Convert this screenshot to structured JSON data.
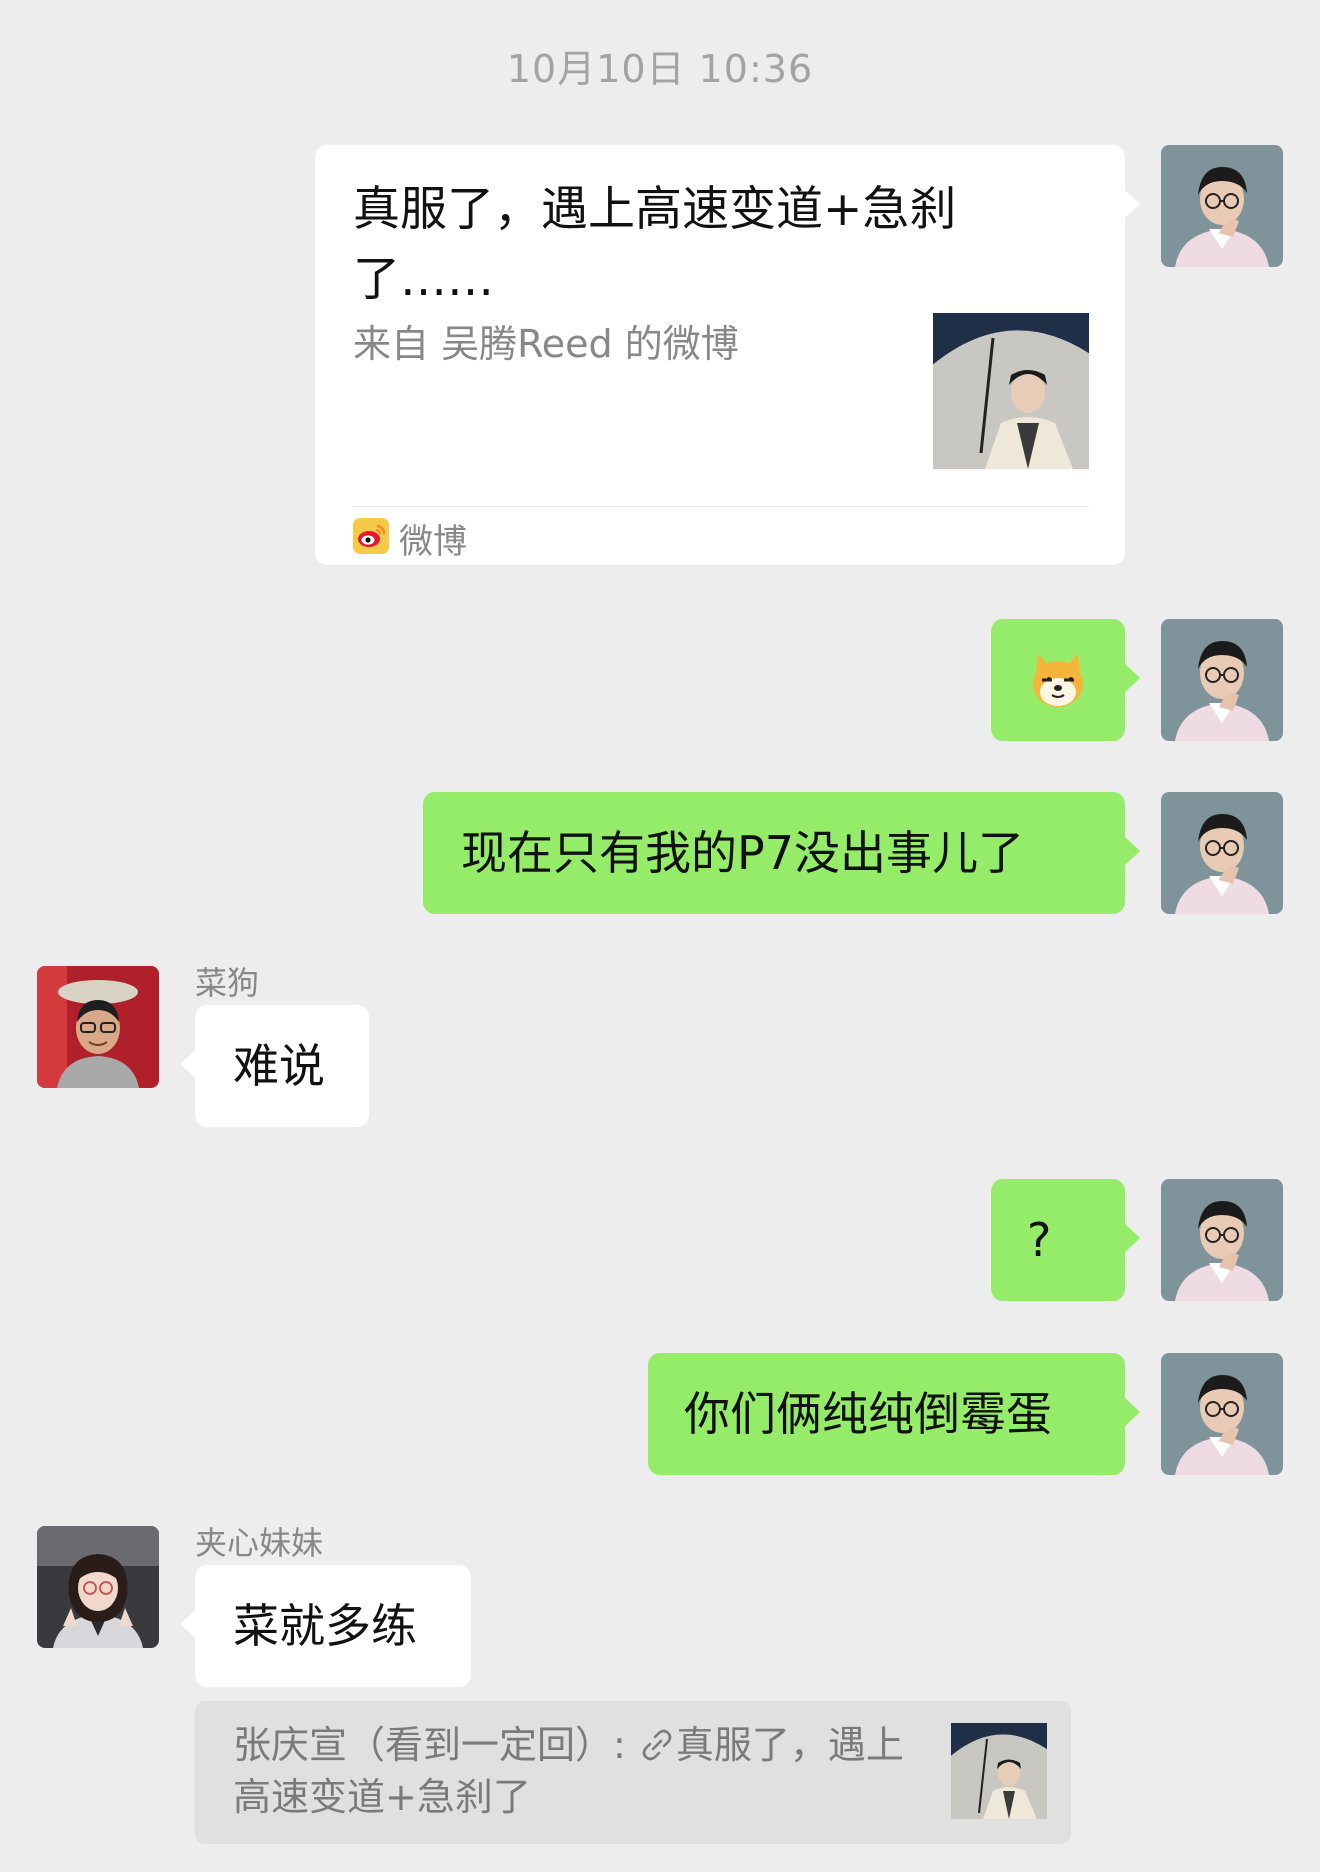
{
  "chat": {
    "timestamp": "10月10日 10:36",
    "card": {
      "title": "真服了，遇上高速变道+急刹了……",
      "from": "来自 吴腾Reed 的微博",
      "source": "微博"
    },
    "messages": {
      "sticker_name": "doge-sticker",
      "msg2": "现在只有我的P7没出事儿了",
      "msg3_sender": "菜狗",
      "msg3": "难说",
      "msg4": "?",
      "msg5": "你们俩纯纯倒霉蛋",
      "msg6_sender": "夹心妹妹",
      "msg6": "菜就多练"
    },
    "quote": {
      "line1": "张庆宣（看到一定回）: ",
      "line1_after_icon": "真服了，遇上",
      "line2": "高速变道+急刹了"
    },
    "colors": {
      "background": "#ededed",
      "green_bubble": "#95ec69",
      "white_bubble": "#ffffff",
      "weibo_red": "#e6162d",
      "weibo_yellow": "#f5a623"
    }
  }
}
